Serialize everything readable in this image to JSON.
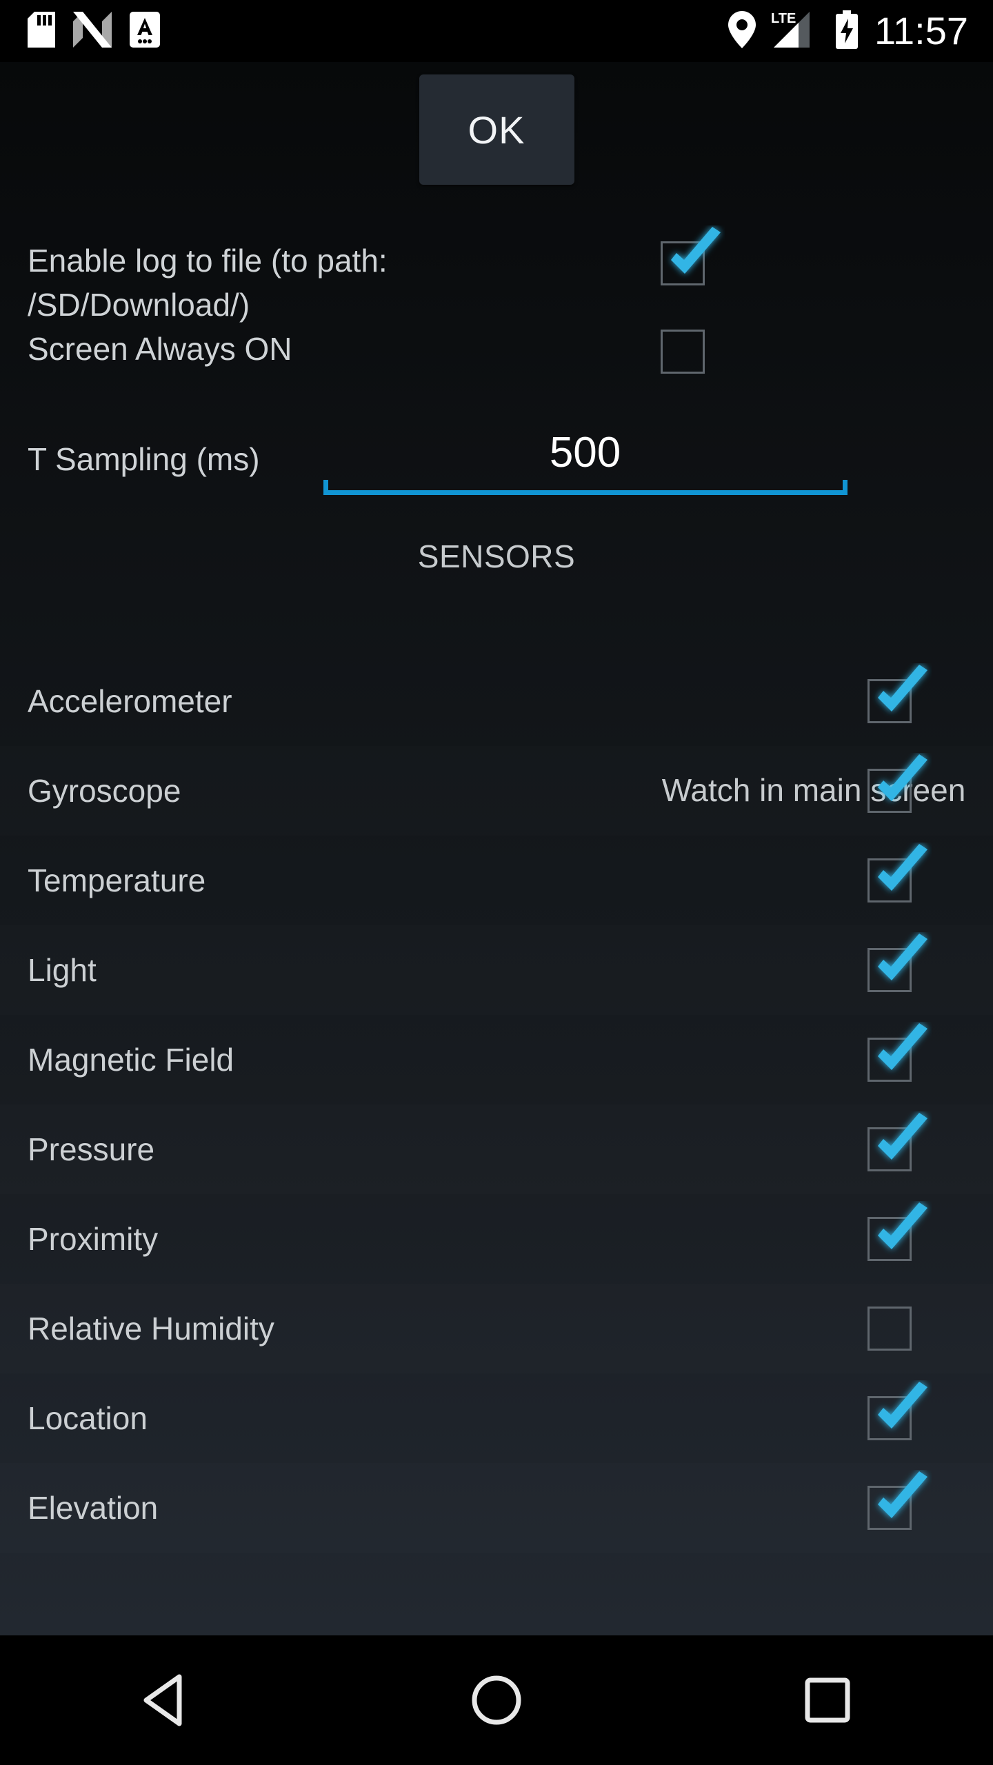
{
  "status_bar": {
    "clock": "11:57",
    "left_icons": [
      {
        "name": "sd-card-icon"
      },
      {
        "name": "android-nougat-icon"
      },
      {
        "name": "keyboard-input-method-icon"
      }
    ],
    "right_icons": [
      {
        "name": "location-pin-icon"
      },
      {
        "name": "lte-signal-icon",
        "label": "LTE"
      },
      {
        "name": "battery-charging-icon"
      }
    ]
  },
  "colors": {
    "accent_check": "#33b5e5",
    "accent_underline": "#1195d4",
    "button_bg": "#252b33",
    "text_primary": "#ccd0d3",
    "checkbox_border": "#5f666d"
  },
  "toolbar": {
    "ok_label": "OK"
  },
  "options": [
    {
      "label": "Enable log to file (to path: /SD/Download/)",
      "checked": true
    },
    {
      "label": "Screen Always ON",
      "checked": false
    }
  ],
  "sampling": {
    "label": "T Sampling (ms)",
    "value": "500",
    "placeholder": "500"
  },
  "sensors_section": {
    "title": "SENSORS",
    "column_header": "Watch in main screen"
  },
  "sensors": [
    {
      "label": "Accelerometer",
      "checked": true
    },
    {
      "label": "Gyroscope",
      "checked": true
    },
    {
      "label": "Temperature",
      "checked": true
    },
    {
      "label": "Light",
      "checked": true
    },
    {
      "label": "Magnetic Field",
      "checked": true
    },
    {
      "label": "Pressure",
      "checked": true
    },
    {
      "label": "Proximity",
      "checked": true
    },
    {
      "label": "Relative Humidity",
      "checked": false
    },
    {
      "label": "Location",
      "checked": true
    },
    {
      "label": "Elevation",
      "checked": true
    }
  ],
  "nav_bar": [
    {
      "name": "back-button"
    },
    {
      "name": "home-button"
    },
    {
      "name": "recents-button"
    }
  ]
}
